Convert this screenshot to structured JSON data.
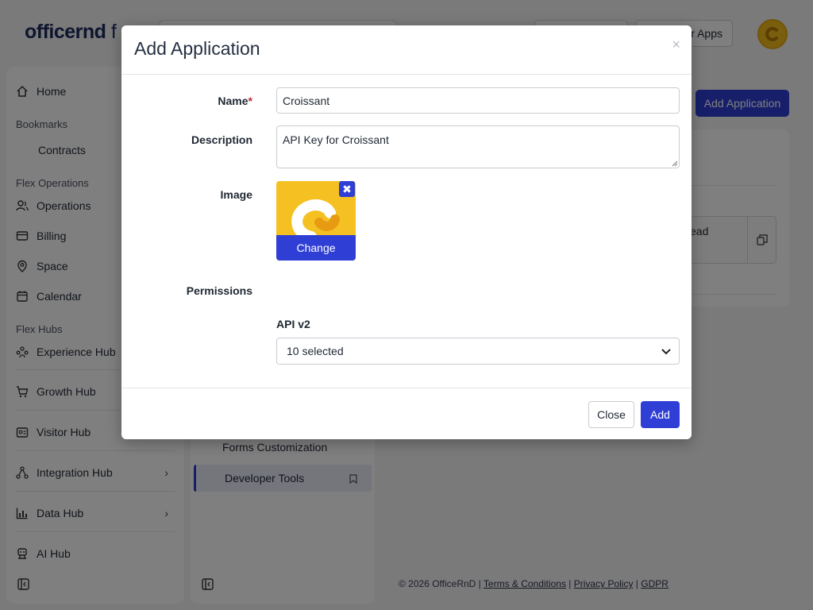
{
  "app": {
    "logo_bold": "officernd",
    "logo_light": " f",
    "top_buttons": [
      "",
      "er Apps"
    ]
  },
  "sidebar": {
    "home": "Home",
    "bookmarks_section": "Bookmarks",
    "contracts": "Contracts",
    "flex_operations_section": "Flex Operations",
    "operations": "Operations",
    "billing": "Billing",
    "space": "Space",
    "calendar": "Calendar",
    "flex_hubs_section": "Flex Hubs",
    "experience_hub": "Experience Hub",
    "growth_hub": "Growth Hub",
    "visitor_hub": "Visitor Hub",
    "integration_hub": "Integration Hub",
    "data_hub": "Data Hub",
    "ai_hub": "AI Hub"
  },
  "subpanel": {
    "forms_customization": "Forms Customization",
    "developer_tools": "Developer Tools"
  },
  "content": {
    "add_application_button": "Add Application",
    "card_text": "ead"
  },
  "footer": {
    "copyright": "© 2026 OfficeRnD",
    "terms": "Terms & Conditions",
    "privacy": "Privacy Policy",
    "gdpr": "GDPR",
    "sep": " | "
  },
  "modal": {
    "title": "Add Application",
    "close_symbol": "×",
    "name_label": "Name",
    "required_mark": "*",
    "name_value": "Croissant",
    "description_label": "Description",
    "description_value": "API Key for Croissant",
    "image_label": "Image",
    "image_remove_symbol": "✖",
    "image_change": "Change",
    "permissions_label": "Permissions",
    "api_label": "API v2",
    "api_selected": "10 selected",
    "close_button": "Close",
    "add_button": "Add"
  },
  "colors": {
    "primary": "#2f3fd6",
    "brand_yellow": "#f5c021",
    "overlay": "rgba(0,0,0,0.5)"
  }
}
